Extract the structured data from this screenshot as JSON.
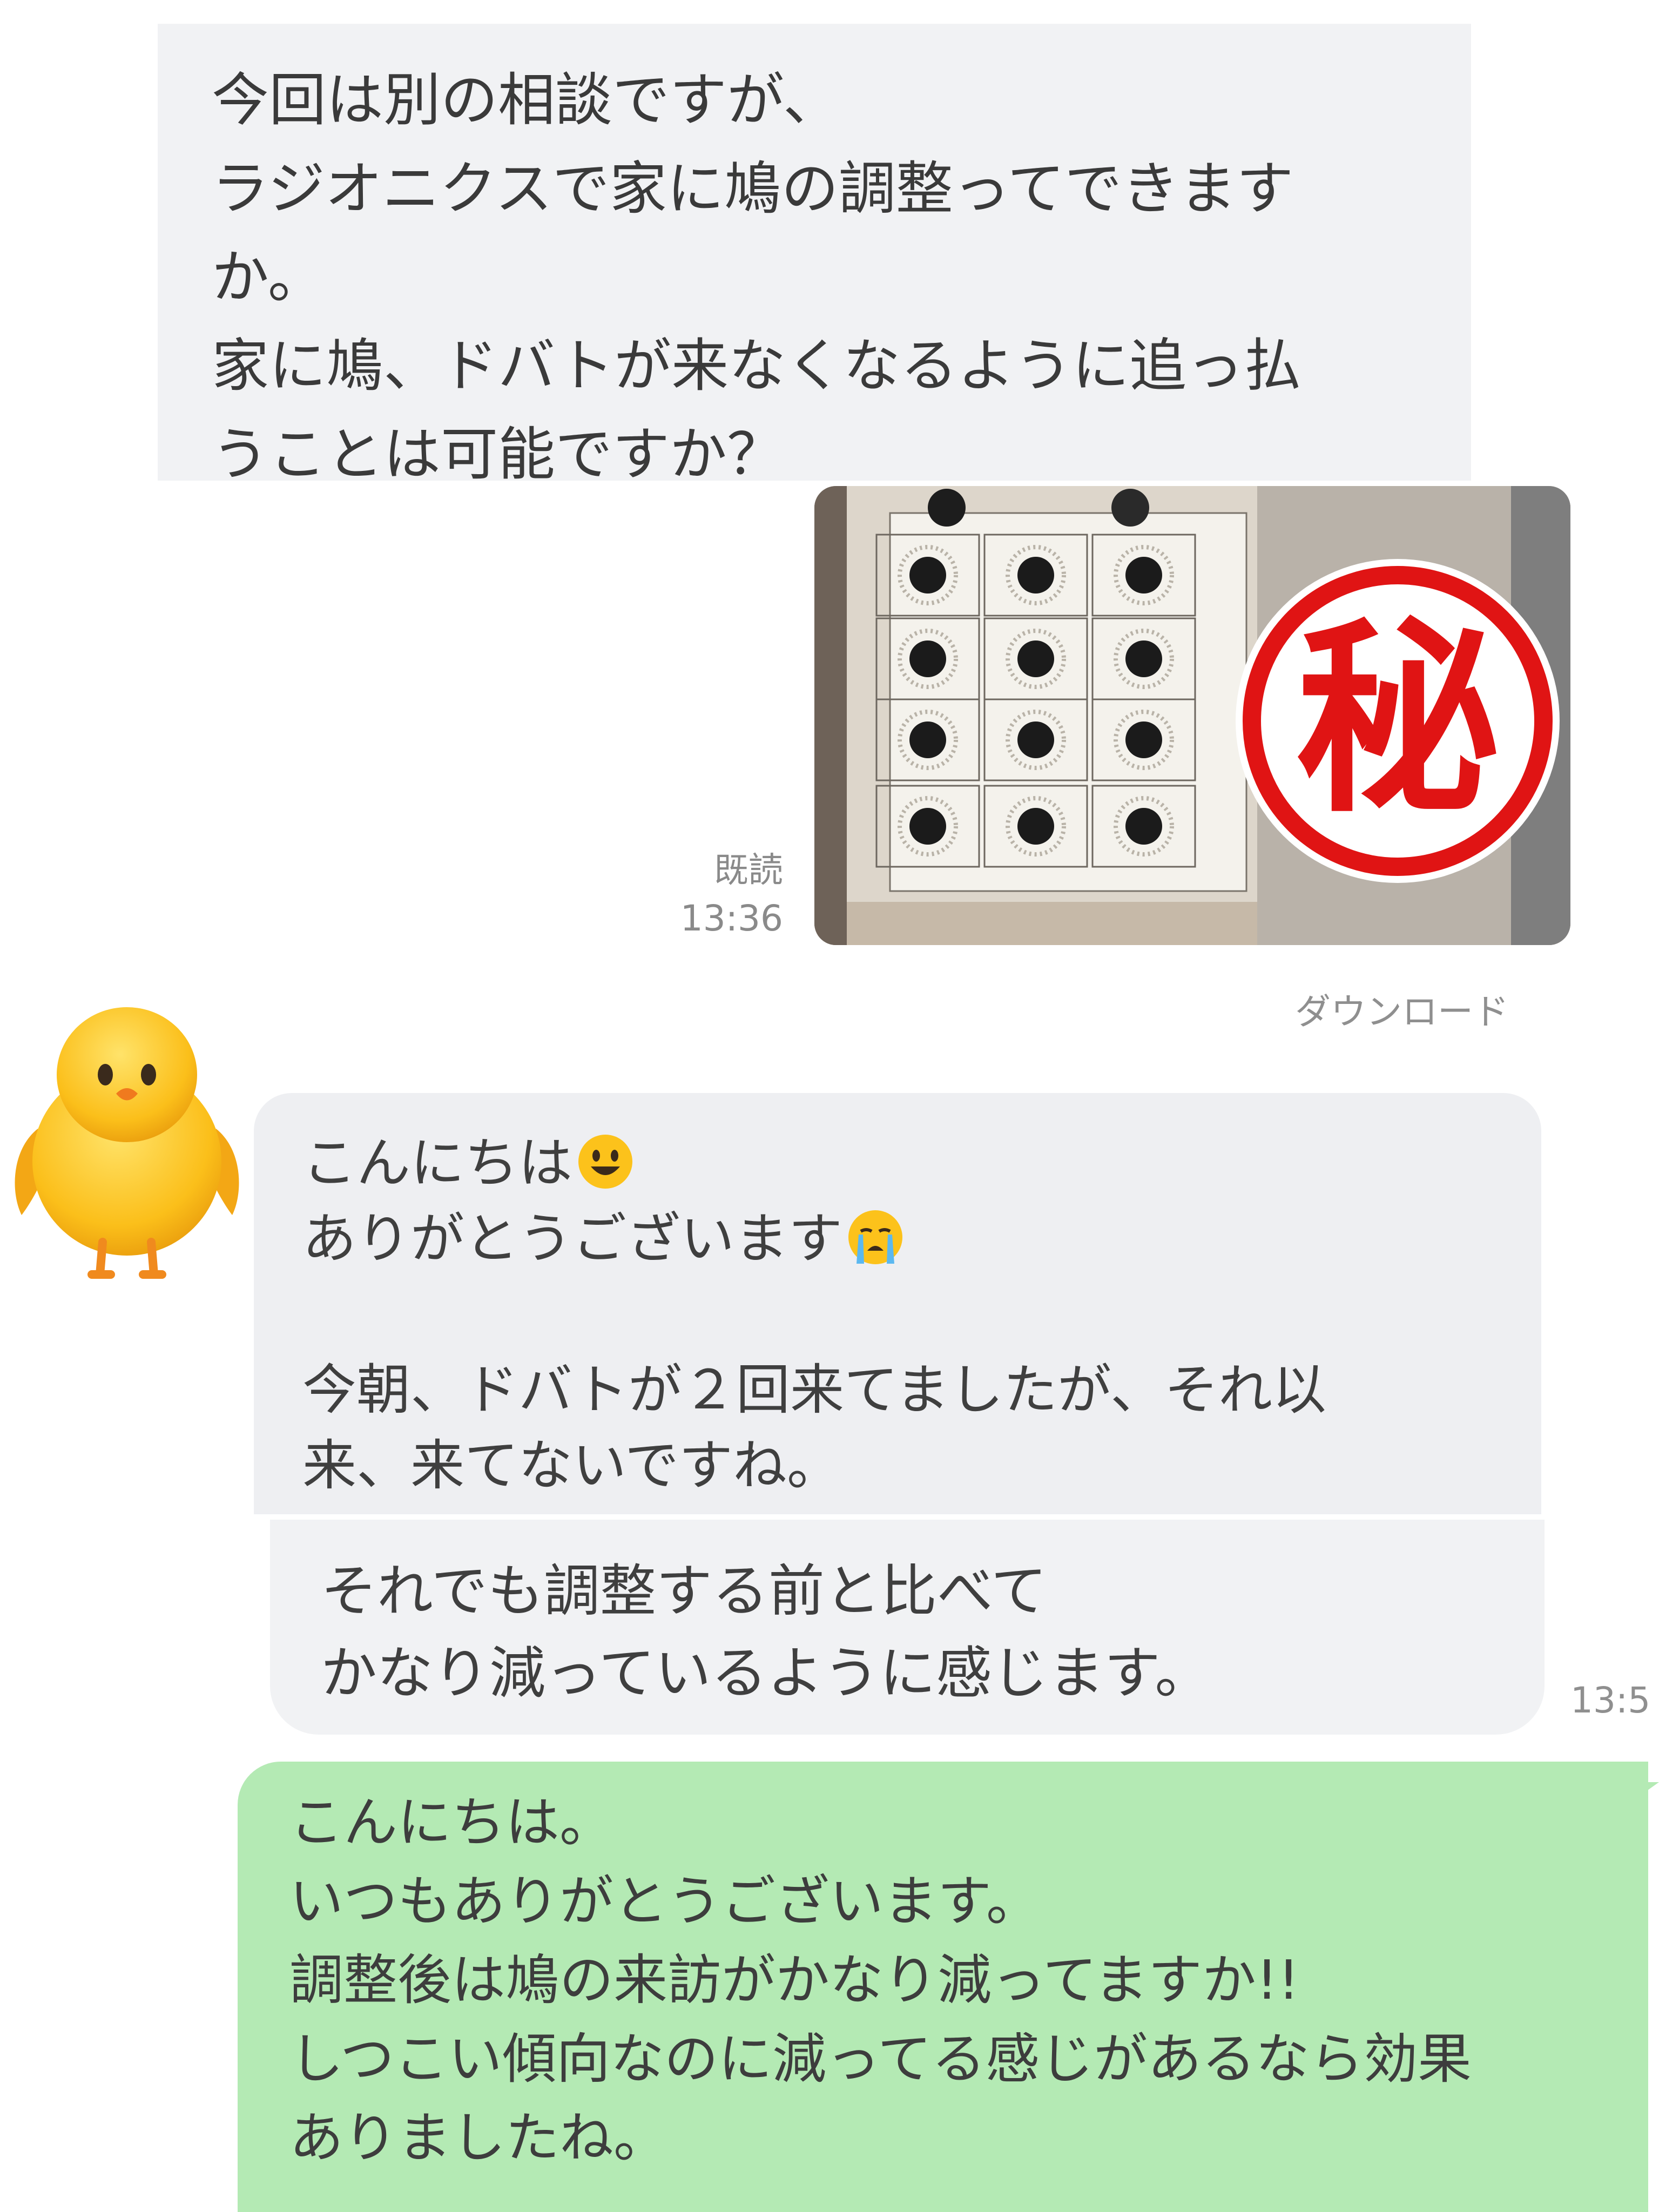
{
  "sent_message": {
    "lines": [
      "今回は別の相談ですが、",
      "ラジオニクスで家に鳩の調整ってできます",
      "か。",
      "家に鳩、ドバトが来なくなるように追っ払",
      "うことは可能ですか？"
    ]
  },
  "photo": {
    "stamp_text": "秘",
    "stamp_color": "#e01414"
  },
  "receipt": {
    "read_label": "既読",
    "time": "13:36"
  },
  "download_label": "ダウンロード",
  "incoming": {
    "avatar_icon": "baby-chick-icon",
    "line1": "こんにちは",
    "line1_emoji": "smiling-face-icon",
    "line2": "ありがとうございます",
    "line2_emoji": "crying-face-icon",
    "line3": "今朝、ドバトが２回来てましたが、それ以",
    "line4": "来、来てないですね。",
    "line5": "それでも調整する前と比べて",
    "line6": "かなり減っているように感じます。",
    "time": "13:5"
  },
  "outgoing": {
    "lines": [
      "こんにちは。",
      "いつもありがとうございます。",
      "調整後は鳩の来訪がかなり減ってますか!!",
      "しつこい傾向なのに減ってる感じがあるなら効果",
      "ありましたね。"
    ],
    "bubble_color": "#b4eab4"
  }
}
